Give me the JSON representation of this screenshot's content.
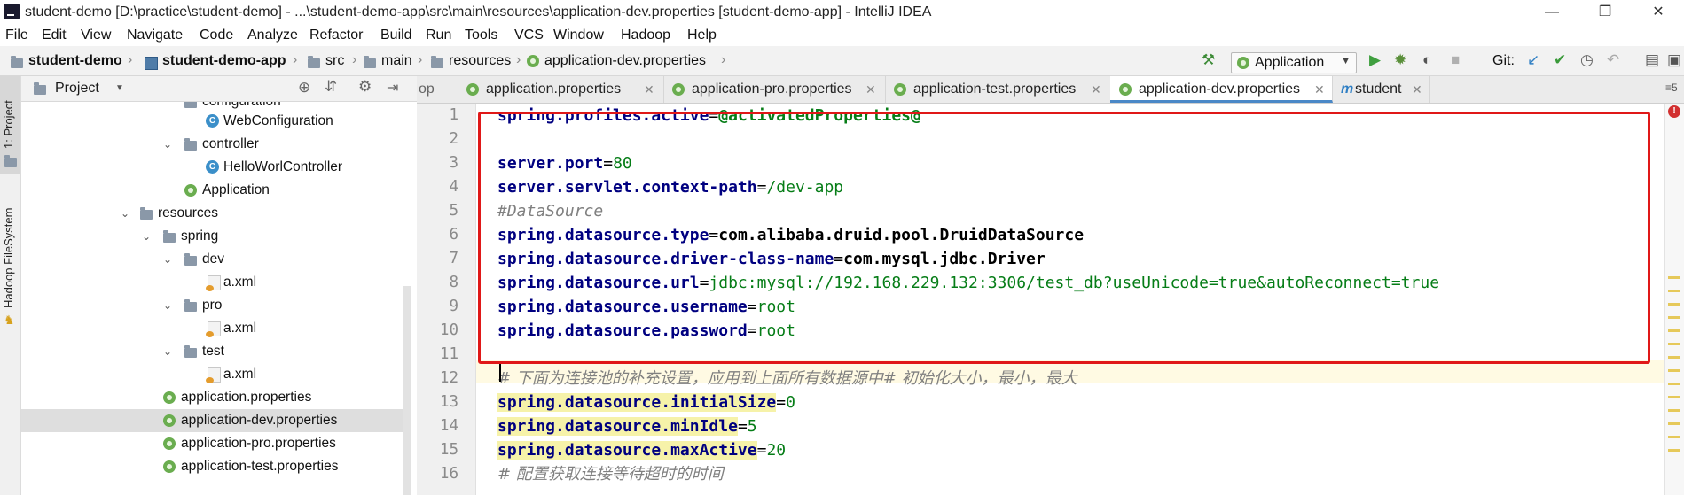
{
  "window": {
    "title": "student-demo [D:\\practice\\student-demo] - ...\\student-demo-app\\src\\main\\resources\\application-dev.properties [student-demo-app] - IntelliJ IDEA",
    "minimize": "—",
    "maximize": "❐",
    "close": "✕"
  },
  "menu": [
    "File",
    "Edit",
    "View",
    "Navigate",
    "Code",
    "Analyze",
    "Refactor",
    "Build",
    "Run",
    "Tools",
    "VCS",
    "Window",
    "Hadoop",
    "Help"
  ],
  "breadcrumb": [
    "student-demo",
    "student-demo-app",
    "src",
    "main",
    "resources",
    "application-dev.properties"
  ],
  "toolbar": {
    "run_config": "Application",
    "git_label": "Git:"
  },
  "left_strip": {
    "project_tab": "1: Project",
    "hadoop_tab": "Hadoop FileSystem"
  },
  "project_panel": {
    "title": "Project",
    "tree": [
      {
        "label": "configuration",
        "kind": "folder"
      },
      {
        "label": "WebConfiguration",
        "kind": "class"
      },
      {
        "label": "controller",
        "kind": "folder"
      },
      {
        "label": "HelloWorlController",
        "kind": "class"
      },
      {
        "label": "Application",
        "kind": "app"
      },
      {
        "label": "resources",
        "kind": "folder"
      },
      {
        "label": "spring",
        "kind": "folder"
      },
      {
        "label": "dev",
        "kind": "folder"
      },
      {
        "label": "a.xml",
        "kind": "xml"
      },
      {
        "label": "pro",
        "kind": "folder"
      },
      {
        "label": "a.xml",
        "kind": "xml"
      },
      {
        "label": "test",
        "kind": "folder"
      },
      {
        "label": "a.xml",
        "kind": "xml"
      },
      {
        "label": "application.properties",
        "kind": "props"
      },
      {
        "label": "application-dev.properties",
        "kind": "props",
        "selected": true
      },
      {
        "label": "application-pro.properties",
        "kind": "props"
      },
      {
        "label": "application-test.properties",
        "kind": "props"
      }
    ]
  },
  "editor_tabs": [
    {
      "label": "op"
    },
    {
      "label": "application.properties"
    },
    {
      "label": "application-pro.properties"
    },
    {
      "label": "application-test.properties"
    },
    {
      "label": "application-dev.properties",
      "active": true
    },
    {
      "label": "student"
    }
  ],
  "tabs_overflow": "≡5",
  "line_numbers": [
    "1",
    "2",
    "3",
    "4",
    "5",
    "6",
    "7",
    "8",
    "9",
    "10",
    "11",
    "12",
    "13",
    "14",
    "15",
    "16"
  ],
  "code": {
    "l1_key": "spring.profiles.active",
    "l1_val": "@activatedProperties@",
    "l3_key": "server.port",
    "l3_val": "80",
    "l4_key": "server.servlet.context-path",
    "l4_val": "/dev-app",
    "l5_comment": "#DataSource",
    "l6_key": "spring.datasource.type",
    "l6_val": "com.alibaba.druid.pool.DruidDataSource",
    "l7_key": "spring.datasource.driver-class-name",
    "l7_val": "com.mysql.jdbc.Driver",
    "l8_key": "spring.datasource.url",
    "l8_val": "jdbc:mysql://192.168.229.132:3306/test_db?useUnicode=true&autoReconnect=true",
    "l9_key": "spring.datasource.username",
    "l9_val": "root",
    "l10_key": "spring.datasource.password",
    "l10_val": "root",
    "l12_comment": "# 下面为连接池的补充设置，应用到上面所有数据源中# 初始化大小，最小，最大",
    "l13_key": "spring.datasource.initialSize",
    "l13_val": "0",
    "l14_key": "spring.datasource.minIdle",
    "l14_val": "5",
    "l15_key": "spring.datasource.maxActive",
    "l15_val": "20",
    "l16_comment": "# 配置获取连接等待超时的时间",
    "equals": "="
  },
  "colors": {
    "key": "#000080",
    "value": "#067d17",
    "comment": "#808080",
    "highlight_box": "#e01818"
  }
}
